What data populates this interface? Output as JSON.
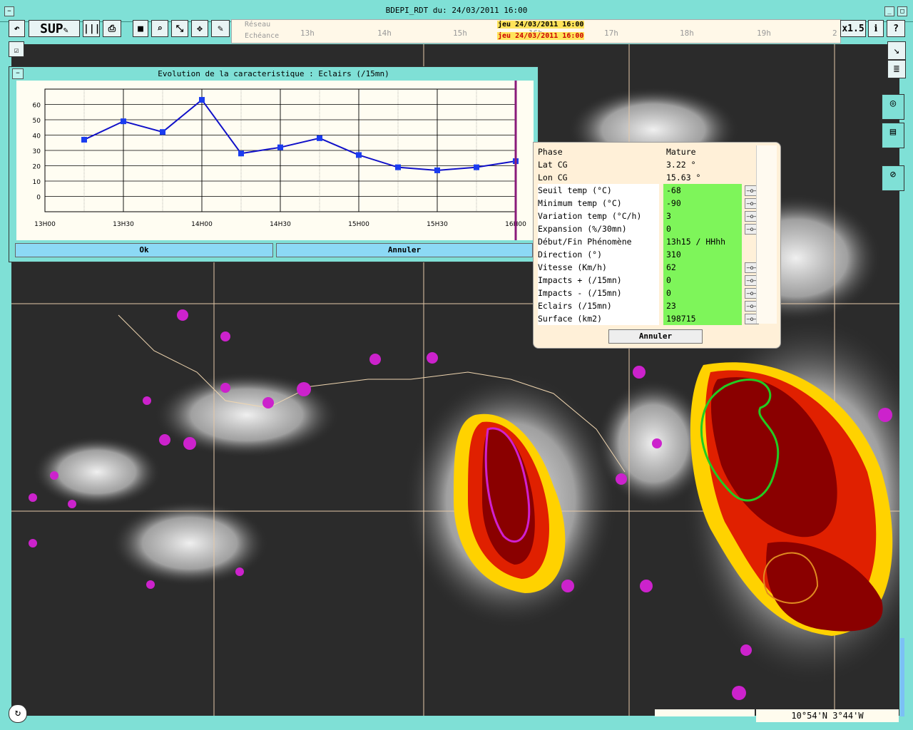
{
  "window": {
    "title": "BDEPI_RDT du: 24/03/2011 16:00"
  },
  "toolbar": {
    "sup_label": "SUP",
    "zoom_label": "x1.5"
  },
  "timeline": {
    "reseau_label": "Réseau",
    "echeance_label": "Echéance",
    "reseau_date": "jeu 24/03/2011 16:00",
    "echeance_date": "jeu 24/03/2011 16:00",
    "hours": [
      "13h",
      "14h",
      "15h",
      "16h",
      "17h",
      "18h",
      "19h",
      "2"
    ]
  },
  "chart_window": {
    "title": "Evolution de la caracteristique : Eclairs (/15mn)",
    "ok_label": "Ok",
    "cancel_label": "Annuler"
  },
  "chart_data": {
    "type": "line",
    "x": [
      "13H15",
      "13H30",
      "13H45",
      "14H00",
      "14H15",
      "14H30",
      "14H45",
      "15H00",
      "15H15",
      "15H30",
      "15H45",
      "16H00"
    ],
    "values": [
      37,
      49,
      42,
      63,
      28,
      32,
      38,
      27,
      19,
      17,
      19,
      23
    ],
    "tick_labels": [
      "13H00",
      "13H30",
      "14H00",
      "14H30",
      "15H00",
      "15H30",
      "16H00"
    ],
    "y_ticks": [
      "60",
      "50",
      "40",
      "30",
      "20",
      "10",
      "0"
    ],
    "ylim": [
      -10,
      70
    ],
    "grid": true,
    "colors": {
      "line": "#1010c8",
      "marker": "#1a3cf0",
      "current": "#8a1a7a"
    }
  },
  "info_panel": {
    "rows": [
      {
        "label": "Phase",
        "value": "Mature",
        "style": "h"
      },
      {
        "label": "Lat CG",
        "value": "3.22 °",
        "style": "h"
      },
      {
        "label": "Lon CG",
        "value": "15.63 °",
        "style": "h"
      },
      {
        "label": "Seuil temp (°C)",
        "value": "-68",
        "style": "g",
        "spin": true
      },
      {
        "label": "Minimum temp (°C)",
        "value": "-90",
        "style": "g",
        "spin": true
      },
      {
        "label": "Variation temp (°C/h)",
        "value": "3",
        "style": "g",
        "spin": true
      },
      {
        "label": "Expansion (%/30mn)",
        "value": "0",
        "style": "g",
        "spin": true
      },
      {
        "label": "Début/Fin Phénomène",
        "value": "13h15 / HHhh",
        "style": "g",
        "spin": false
      },
      {
        "label": "Direction (°)",
        "value": "310",
        "style": "g",
        "spin": false
      },
      {
        "label": "Vitesse (Km/h)",
        "value": "62",
        "style": "g",
        "spin": true
      },
      {
        "label": "Impacts + (/15mn)",
        "value": "0",
        "style": "g",
        "spin": true
      },
      {
        "label": "Impacts - (/15mn)",
        "value": "0",
        "style": "g",
        "spin": true
      },
      {
        "label": "Eclairs (/15mn)",
        "value": "23",
        "style": "g",
        "spin": true
      },
      {
        "label": "Surface (km2)",
        "value": "198715",
        "style": "g",
        "spin": true
      }
    ],
    "cancel_label": "Annuler"
  },
  "status": {
    "coords": "10°54'N 3°44'W"
  }
}
